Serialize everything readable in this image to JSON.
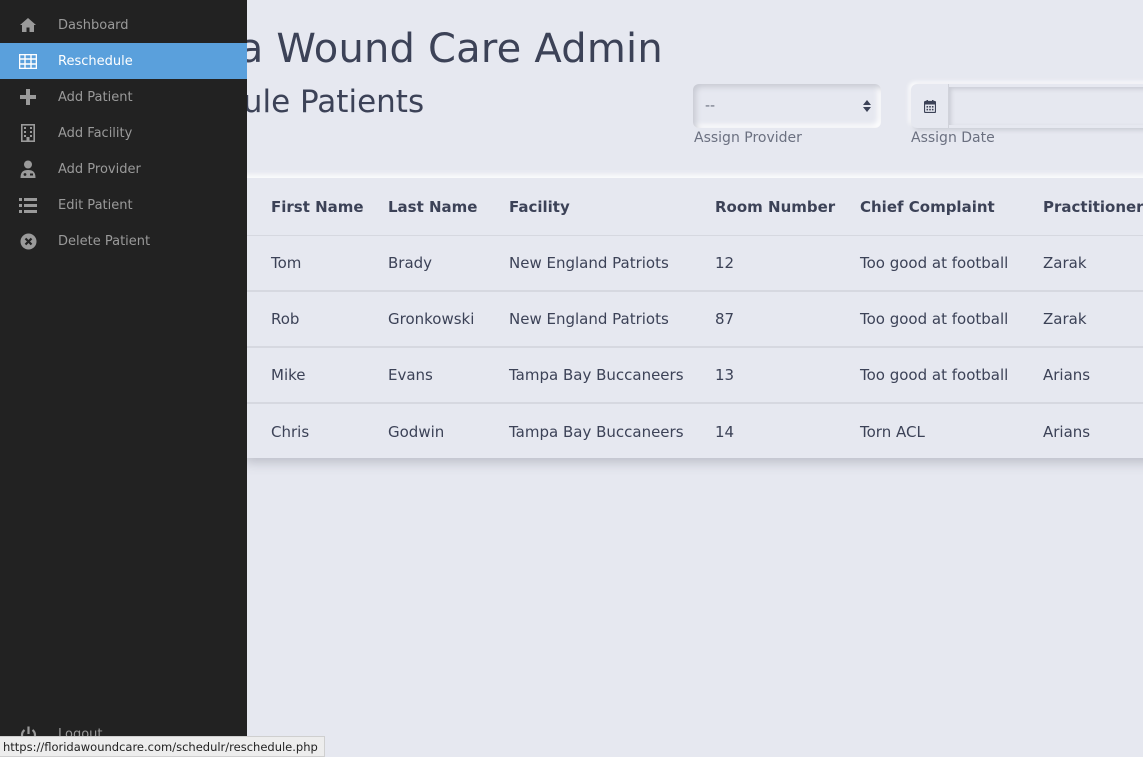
{
  "app": {
    "title": "Florida Wound Care Admin"
  },
  "page": {
    "title": "Reschedule Patients"
  },
  "filters": {
    "provider_value": "--",
    "provider_label": "Assign Provider",
    "date_label": "Assign Date",
    "date_value": ""
  },
  "table": {
    "headers": [
      "First Name",
      "Last Name",
      "Facility",
      "Room Number",
      "Chief Complaint",
      "Practitioner"
    ],
    "rows": [
      [
        "Tom",
        "Brady",
        "New England Patriots",
        "12",
        "Too good at football",
        "Zarak"
      ],
      [
        "Rob",
        "Gronkowski",
        "New England Patriots",
        "87",
        "Too good at football",
        "Zarak"
      ],
      [
        "Mike",
        "Evans",
        "Tampa Bay Buccaneers",
        "13",
        "Too good at football",
        "Arians"
      ],
      [
        "Chris",
        "Godwin",
        "Tampa Bay Buccaneers",
        "14",
        "Torn ACL",
        "Arians"
      ]
    ]
  },
  "sidebar": {
    "items": [
      {
        "label": "Dashboard",
        "icon": "home-icon"
      },
      {
        "label": "Reschedule",
        "icon": "table-icon",
        "active": true
      },
      {
        "label": "Add Patient",
        "icon": "plus-icon"
      },
      {
        "label": "Add Facility",
        "icon": "building-icon"
      },
      {
        "label": "Add Provider",
        "icon": "user-md-icon"
      },
      {
        "label": "Edit Patient",
        "icon": "list-icon"
      },
      {
        "label": "Delete Patient",
        "icon": "times-circle-icon"
      }
    ],
    "logout_label": "Logout"
  },
  "status_bar": {
    "url": "https://floridawoundcare.com/schedulr/reschedule.php"
  },
  "colors": {
    "sidebar_bg": "#222222",
    "active_item": "#5aa0dc",
    "page_bg": "#e6e8f0",
    "text": "#3c4257"
  }
}
